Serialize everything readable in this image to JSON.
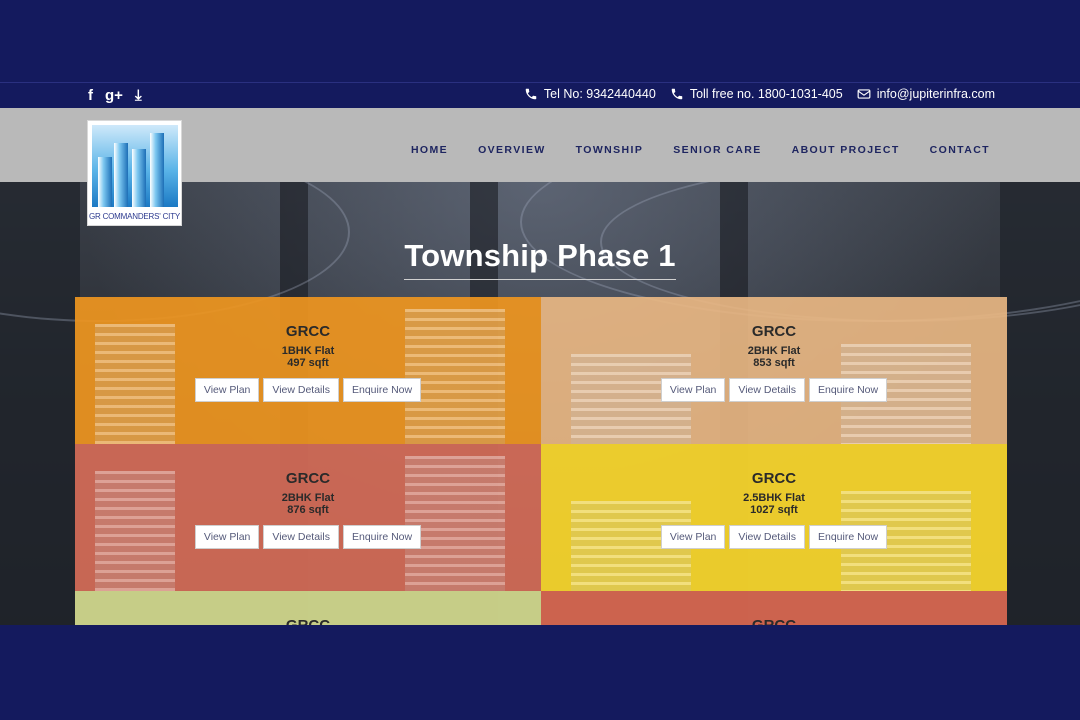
{
  "social": {
    "facebook_glyph": "f",
    "googleplus_glyph": "g+",
    "download_glyph": "⤓"
  },
  "contact": {
    "tel": "Tel No: 9342440440",
    "tollfree": "Toll free no. 1800-1031-405",
    "email": "info@jupiterinfra.com"
  },
  "logo": {
    "caption": "GR COMMANDERS' CITY"
  },
  "nav": {
    "items": [
      "HOME",
      "OVERVIEW",
      "TOWNSHIP",
      "SENIOR CARE",
      "ABOUT PROJECT",
      "CONTACT"
    ]
  },
  "page": {
    "title": "Township Phase 1"
  },
  "cards": [
    {
      "name": "GRCC",
      "type": "1BHK Flat",
      "size": "497 sqft",
      "btn_plan": "View Plan",
      "btn_details": "View Details",
      "btn_enquire": "Enquire Now"
    },
    {
      "name": "GRCC",
      "type": "2BHK Flat",
      "size": "853 sqft",
      "btn_plan": "View Plan",
      "btn_details": "View Details",
      "btn_enquire": "Enquire Now"
    },
    {
      "name": "GRCC",
      "type": "2BHK Flat",
      "size": "876 sqft",
      "btn_plan": "View Plan",
      "btn_details": "View Details",
      "btn_enquire": "Enquire Now"
    },
    {
      "name": "GRCC",
      "type": "2.5BHK Flat",
      "size": "1027 sqft",
      "btn_plan": "View Plan",
      "btn_details": "View Details",
      "btn_enquire": "Enquire Now"
    },
    {
      "name": "GRCC"
    },
    {
      "name": "GRCC"
    }
  ],
  "colors": {
    "frame": "#141a5e",
    "header": "#b9b9b9",
    "nav_text": "#1e2560",
    "card_orange": "#ef9620",
    "card_peach": "#ecb984",
    "card_salmon": "#d66c58",
    "card_yellow": "#f5d42c",
    "card_olive": "#d0d68c",
    "card_red": "#d66650"
  }
}
